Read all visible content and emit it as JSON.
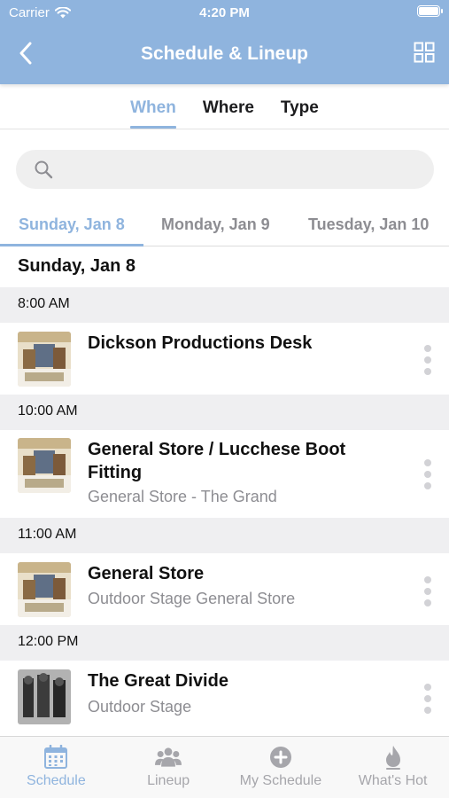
{
  "status_bar": {
    "carrier": "Carrier",
    "time": "4:20 PM"
  },
  "nav": {
    "title": "Schedule & Lineup",
    "back_icon": "chevron-left-icon",
    "grid_icon": "grid-icon"
  },
  "segment_tabs": [
    {
      "label": "When",
      "active": true
    },
    {
      "label": "Where",
      "active": false
    },
    {
      "label": "Type",
      "active": false
    }
  ],
  "search": {
    "placeholder": "",
    "value": ""
  },
  "day_tabs": [
    {
      "label": "Sunday, Jan 8",
      "active": true
    },
    {
      "label": "Monday, Jan 9",
      "active": false
    },
    {
      "label": "Tuesday, Jan 10",
      "active": false
    }
  ],
  "list": {
    "section_date": "Sunday, Jan 8",
    "groups": [
      {
        "time": "8:00 AM",
        "events": [
          {
            "title": "Dickson Productions Desk",
            "subtitle": ""
          }
        ]
      },
      {
        "time": "10:00 AM",
        "events": [
          {
            "title": "General Store / Lucchese Boot Fitting",
            "subtitle": "General Store - The Grand"
          }
        ]
      },
      {
        "time": "11:00 AM",
        "events": [
          {
            "title": "General Store",
            "subtitle": "Outdoor Stage General Store"
          }
        ]
      },
      {
        "time": "12:00 PM",
        "events": [
          {
            "title": "The Great Divide",
            "subtitle": "Outdoor Stage"
          }
        ]
      }
    ]
  },
  "tabbar": [
    {
      "label": "Schedule",
      "icon": "calendar-icon",
      "active": true
    },
    {
      "label": "Lineup",
      "icon": "people-icon",
      "active": false
    },
    {
      "label": "My Schedule",
      "icon": "plus-circle-icon",
      "active": false
    },
    {
      "label": "What's Hot",
      "icon": "flame-icon",
      "active": false
    }
  ],
  "colors": {
    "accent": "#8fb4de",
    "inactive": "#8d8d92",
    "row_bg": "#efeff1"
  }
}
